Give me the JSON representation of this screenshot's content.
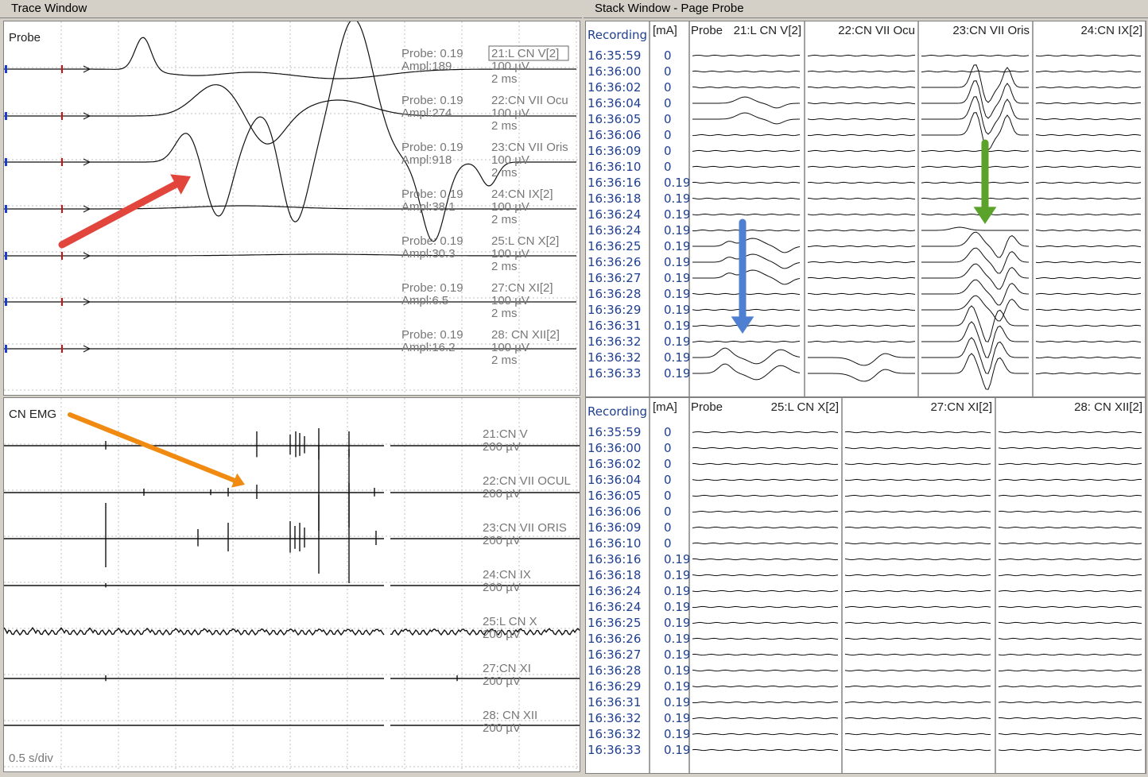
{
  "trace_window": {
    "title": "Trace Window",
    "probe_panel": {
      "label": "Probe",
      "channels": [
        {
          "stim": "Probe: 0.19",
          "ampl": "Ampl:189",
          "name": "21:L CN V[2]",
          "gain": "100 µV",
          "time": "2 ms",
          "boxed": true,
          "highlight": false
        },
        {
          "stim": "Probe: 0.19",
          "ampl": "Ampl:274",
          "name": "22:CN VII Ocu",
          "gain": "100 µV",
          "time": "2 ms",
          "boxed": false,
          "highlight": false
        },
        {
          "stim": "Probe: 0.19",
          "ampl": "Ampl:918",
          "name": "23:CN VII Oris",
          "gain": "100 µV",
          "time": "2 ms",
          "boxed": false,
          "highlight": true
        },
        {
          "stim": "Probe: 0.19",
          "ampl": "Ampl:38.1",
          "name": "24:CN IX[2]",
          "gain": "100 µV",
          "time": "2 ms",
          "boxed": false,
          "highlight": false
        },
        {
          "stim": "Probe: 0.19",
          "ampl": "Ampl:30.3",
          "name": "25:L CN X[2]",
          "gain": "100 µV",
          "time": "2 ms",
          "boxed": false,
          "highlight": false
        },
        {
          "stim": "Probe: 0.19",
          "ampl": "Ampl:6.5",
          "name": "27:CN XI[2]",
          "gain": "100 µV",
          "time": "2 ms",
          "boxed": false,
          "highlight": false
        },
        {
          "stim": "Probe: 0.19",
          "ampl": "Ampl:16.2",
          "name": "28: CN XII[2]",
          "gain": "100 µV",
          "time": "2 ms",
          "boxed": false,
          "highlight": false
        }
      ]
    },
    "emg_panel": {
      "label": "CN EMG",
      "channels": [
        {
          "name": "21:CN V",
          "gain": "200 µV"
        },
        {
          "name": "22:CN VII OCUL",
          "gain": "200 µV"
        },
        {
          "name": "23:CN VII ORIS",
          "gain": "200 µV"
        },
        {
          "name": "24:CN IX",
          "gain": "200 µV"
        },
        {
          "name": "25:L CN X",
          "gain": "200 µV"
        },
        {
          "name": "27:CN XI",
          "gain": "200 µV"
        },
        {
          "name": "28: CN XII",
          "gain": "200 µV"
        }
      ],
      "timebase": "0.5 s/div"
    }
  },
  "stack_window": {
    "title": "Stack Window - Page Probe",
    "unit_header": "[mA]",
    "partial_label": "Recording",
    "upper": {
      "columns": [
        "Probe",
        "21:L CN V[2]",
        "22:CN VII Ocu",
        "23:CN VII Oris",
        "24:CN IX[2]"
      ],
      "times": [
        "16:35:59",
        "16:36:00",
        "16:36:02",
        "16:36:04",
        "16:36:05",
        "16:36:06",
        "16:36:09",
        "16:36:10",
        "16:36:16",
        "16:36:18",
        "16:36:24",
        "16:36:24",
        "16:36:25",
        "16:36:26",
        "16:36:27",
        "16:36:28",
        "16:36:29",
        "16:36:31",
        "16:36:32",
        "16:36:32",
        "16:36:33"
      ],
      "values": [
        "0",
        "0",
        "0",
        "0",
        "0",
        "0",
        "0",
        "0",
        "0.19",
        "0.19",
        "0.19",
        "0.19",
        "0.19",
        "0.19",
        "0.19",
        "0.19",
        "0.19",
        "0.19",
        "0.19",
        "0.19",
        "0.19"
      ]
    },
    "lower": {
      "columns": [
        "Probe",
        "25:L CN X[2]",
        "27:CN XI[2]",
        "28: CN XII[2]"
      ],
      "times": [
        "16:35:59",
        "16:36:00",
        "16:36:02",
        "16:36:04",
        "16:36:05",
        "16:36:06",
        "16:36:09",
        "16:36:10",
        "16:36:16",
        "16:36:18",
        "16:36:24",
        "16:36:24",
        "16:36:25",
        "16:36:26",
        "16:36:27",
        "16:36:28",
        "16:36:29",
        "16:36:31",
        "16:36:32",
        "16:36:32",
        "16:36:33"
      ],
      "values": [
        "0",
        "0",
        "0",
        "0",
        "0",
        "0",
        "0",
        "0",
        "0.19",
        "0.19",
        "0.19",
        "0.19",
        "0.19",
        "0.19",
        "0.19",
        "0.19",
        "0.19",
        "0.19",
        "0.19",
        "0.19",
        "0.19"
      ]
    }
  },
  "colors": {
    "arrow_red": "#e2453c",
    "arrow_orange": "#f08a10",
    "arrow_blue": "#4f7fd0",
    "arrow_green": "#5aa22a",
    "timestamp_blue": "#1f3f8f",
    "highlight_red": "#cc1111"
  }
}
